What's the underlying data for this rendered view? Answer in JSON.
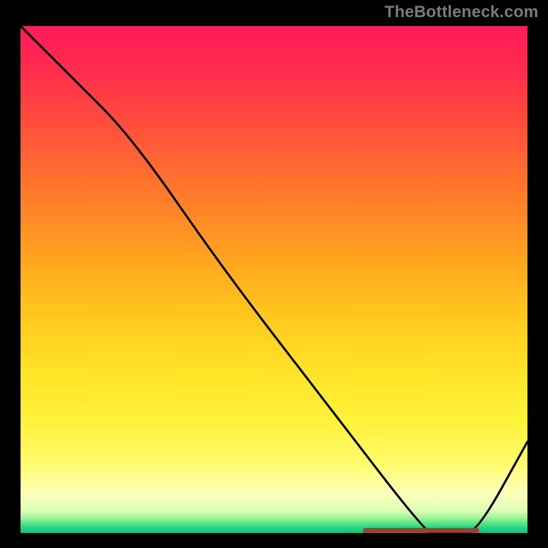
{
  "watermark": "TheBottleneck.com",
  "chart_data": {
    "type": "line",
    "title": "",
    "xlabel": "",
    "ylabel": "",
    "xlim": [
      0,
      100
    ],
    "ylim": [
      0,
      100
    ],
    "grid": false,
    "legend": false,
    "series": [
      {
        "name": "curve",
        "color": "#000000",
        "x": [
          0,
          10,
          22,
          40,
          60,
          80,
          82,
          86,
          90,
          100
        ],
        "values": [
          100,
          90,
          78,
          52,
          26,
          0,
          0,
          0,
          0,
          18
        ]
      },
      {
        "name": "bottom-marker",
        "color": "#b03028",
        "x": [
          68,
          90
        ],
        "values": [
          0.5,
          0.5
        ]
      }
    ],
    "note": "Values are approximate readings from the rendered pixels. The plot has no visible axis ticks or labels; the curve descends from top-left to the bottom near x≈80 then rises toward x=100. A short dark-red horizontal segment sits at the very bottom roughly between x≈68 and x≈90."
  }
}
